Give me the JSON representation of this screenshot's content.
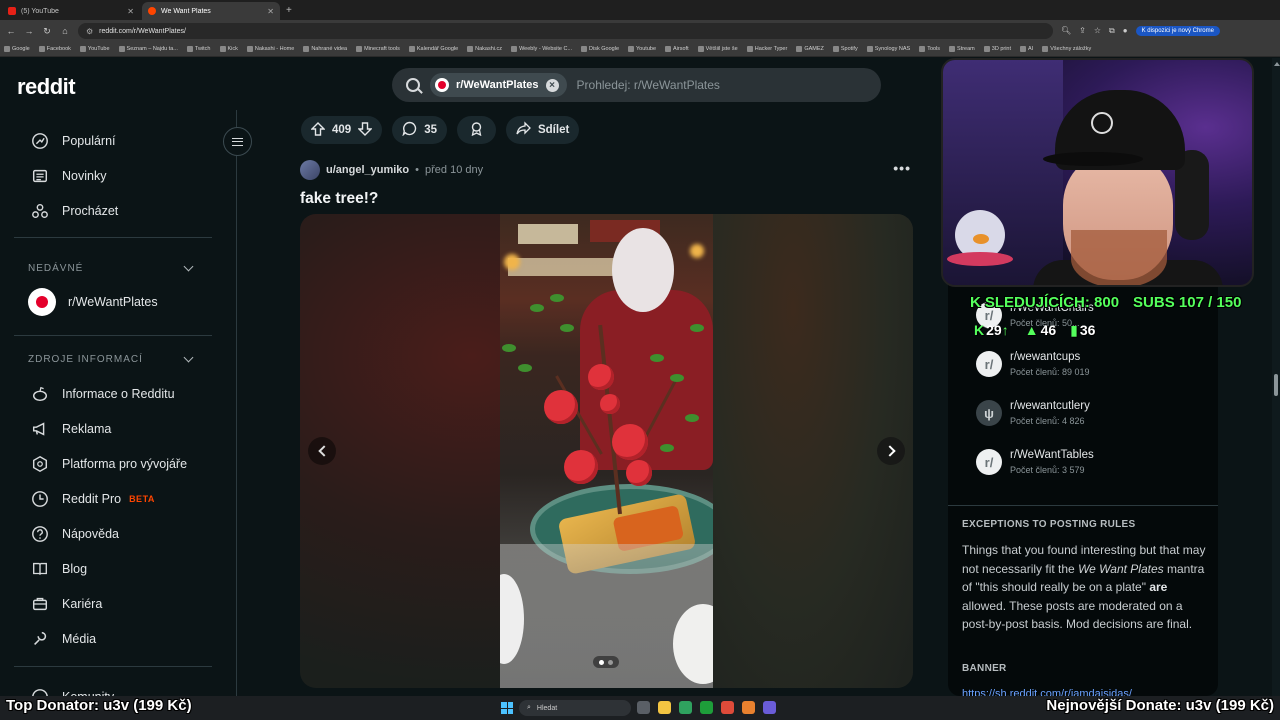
{
  "browser": {
    "tabs": [
      {
        "title": "(5) YouTube",
        "active": false
      },
      {
        "title": "We Want Plates",
        "active": true
      }
    ],
    "url": "reddit.com/r/WeWantPlates/",
    "chrome_update": "K dispozici je nový Chrome",
    "bookmarks": [
      "Google",
      "Facebook",
      "YouTube",
      "Seznam – Najdu ta...",
      "Twitch",
      "Kick",
      "Nakashi - Home",
      "Nahrané videa",
      "Minecraft tools",
      "Kalendář Google",
      "Nakashi.cz",
      "Weebly - Website C...",
      "Disk Google",
      "Youtube",
      "Airsoft",
      "Většiil jste še",
      "Hacker Typer",
      "GAMEZ",
      "Spotify",
      "Synology NAS",
      "Tools",
      "Stream",
      "3D print",
      "AI",
      "Všechny záložky"
    ]
  },
  "header": {
    "logo": "reddit",
    "search_chip": "r/WeWantPlates",
    "search_placeholder": "Prohledej: r/WeWantPlates"
  },
  "sidebar": {
    "nav": [
      {
        "label": "Populární",
        "icon": "popular-icon"
      },
      {
        "label": "Novinky",
        "icon": "news-icon"
      },
      {
        "label": "Procházet",
        "icon": "explore-icon"
      }
    ],
    "recent_header": "NEDÁVNÉ",
    "recent": [
      {
        "label": "r/WeWantPlates"
      }
    ],
    "resources_header": "ZDROJE INFORMACÍ",
    "resources": [
      {
        "label": "Informace o Redditu",
        "icon": "reddit-alien-icon"
      },
      {
        "label": "Reklama",
        "icon": "megaphone-icon"
      },
      {
        "label": "Platforma pro vývojáře",
        "icon": "developer-icon"
      },
      {
        "label": "Reddit Pro",
        "icon": "reddit-pro-icon",
        "badge": "BETA"
      },
      {
        "label": "Nápověda",
        "icon": "help-icon"
      },
      {
        "label": "Blog",
        "icon": "blog-icon"
      },
      {
        "label": "Kariéra",
        "icon": "careers-icon"
      },
      {
        "label": "Média",
        "icon": "media-icon"
      }
    ],
    "partial_item": "Komunity"
  },
  "post": {
    "score": "409",
    "comments": "35",
    "share": "Sdílet",
    "author": "u/angel_yumiko",
    "time": "před 10 dny",
    "title": "fake tree!?",
    "gallery_index": 1,
    "gallery_count": 2
  },
  "right_sidebar": {
    "communities": [
      {
        "name": "r/WeWantChairs",
        "members": "Počet členů: 50..."
      },
      {
        "name": "r/wewantcups",
        "members": "Počet členů: 89 019"
      },
      {
        "name": "r/wewantcutlery",
        "members": "Počet členů: 4 826"
      },
      {
        "name": "r/WeWantTables",
        "members": "Počet členů: 3 579"
      }
    ],
    "exceptions_header": "EXCEPTIONS TO POSTING RULES",
    "exceptions_text_1": "Things that you found interesting but that may not necessarily fit the ",
    "exceptions_em": "We Want Plates",
    "exceptions_text_2": " mantra of \"this should really be on a plate\" ",
    "exceptions_bold": "are",
    "exceptions_text_3": " allowed. These posts are moderated on a post-by-post basis. Mod decisions are final.",
    "banner_header": "BANNER",
    "banner_link": "https://sh.reddit.com/r/jamdaisidas/"
  },
  "stream": {
    "followers": "SLEDUJÍCÍCH: 800",
    "subs": "SUBS 107 / 150",
    "stat_kick": "29",
    "stat_up": "46",
    "stat_bars": "36",
    "top_donator": "Top Donator: u3v (199 Kč)",
    "latest_donate": "Nejnovější Donate: u3v (199 Kč)"
  },
  "taskbar": {
    "search": "Hledat"
  },
  "colors": {
    "accent": "#ff4500",
    "stream_green": "#54ff5c",
    "bg": "#0b1416"
  }
}
